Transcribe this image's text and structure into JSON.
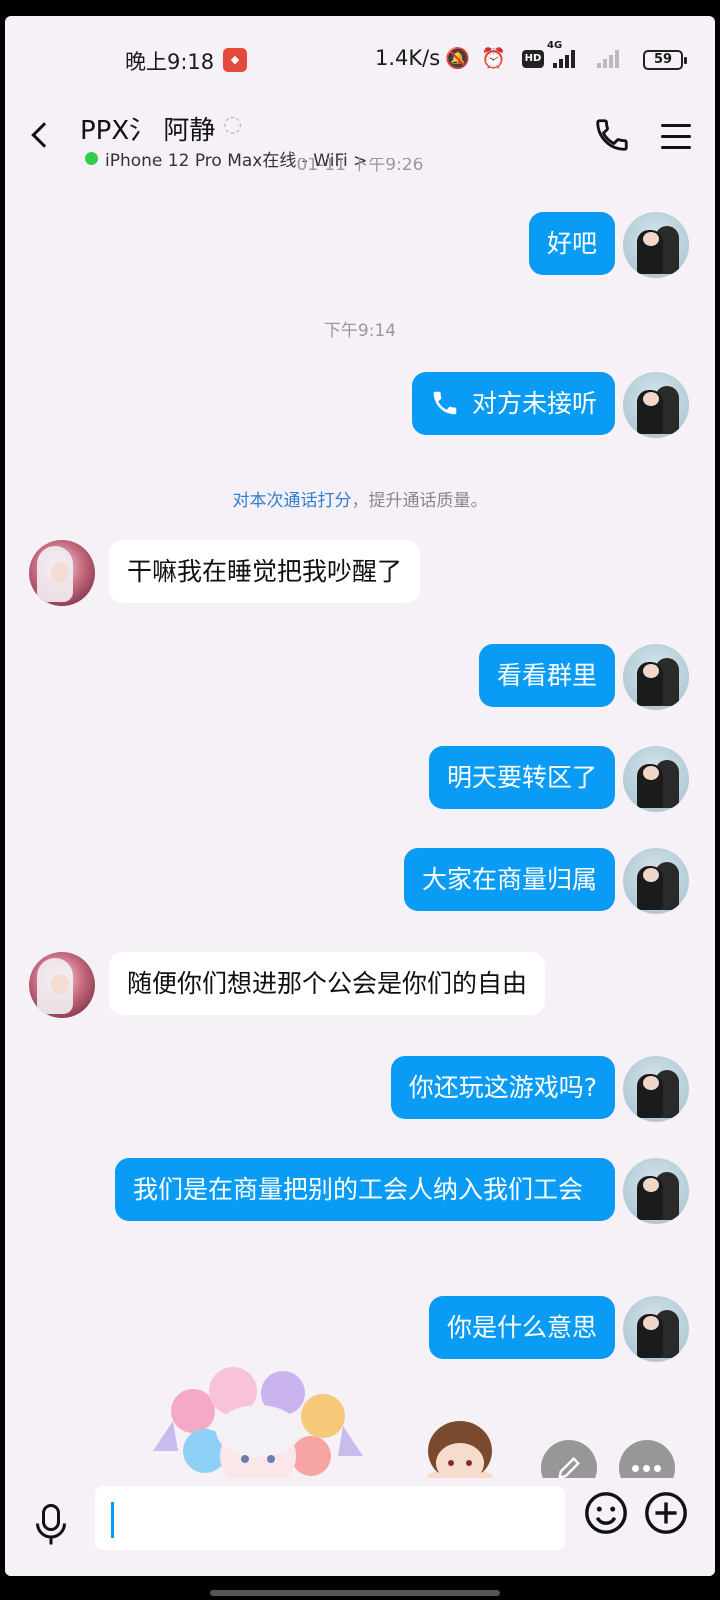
{
  "status_bar": {
    "time": "晚上9:18",
    "speed": "1.4K/s",
    "network_label": "4G",
    "hd_label": "HD",
    "battery": "59"
  },
  "header": {
    "title": "PPX氵 阿静",
    "subtitle": "iPhone 12 Pro Max在线 - WiFi >"
  },
  "messages": {
    "ts_top": "01-11 下午9:26",
    "m1": "好吧",
    "ts_call": "下午9:14",
    "m2_call": "对方未接听",
    "hint_link": "对本次通话打分",
    "hint_rest": "，提升通话质量。",
    "m3": "干嘛我在睡觉把我吵醒了",
    "m4": "看看群里",
    "m5": "明天要转区了",
    "m6": "大家在商量归属",
    "m7": "随便你们想进那个公会是你们的自由",
    "m8": "你还玩这游戏吗?",
    "m9": "我们是在商量把别的工会人纳入我们工会",
    "m10": "你是什么意思"
  },
  "input": {
    "value": "",
    "placeholder": ""
  },
  "colors": {
    "accent": "#0a9cf5",
    "online": "#2fcf4d",
    "background": "#f6f1f7"
  },
  "icons": [
    "back-icon",
    "ear-icon",
    "phone-icon",
    "menu-icon",
    "call-icon",
    "mic-icon",
    "emoji-icon",
    "plus-icon",
    "edit-icon",
    "more-icon"
  ]
}
